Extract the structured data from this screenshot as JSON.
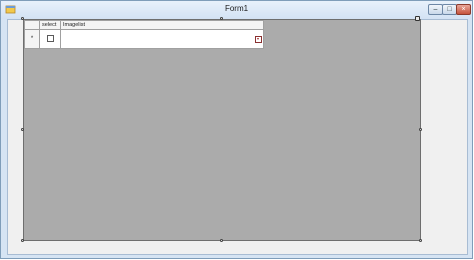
{
  "window": {
    "title": "Form1",
    "controls": {
      "minimize": "–",
      "maximize": "□",
      "close": "×"
    }
  },
  "grid": {
    "columns": [
      "select",
      "Imagelist"
    ],
    "new_row_marker": "*"
  }
}
